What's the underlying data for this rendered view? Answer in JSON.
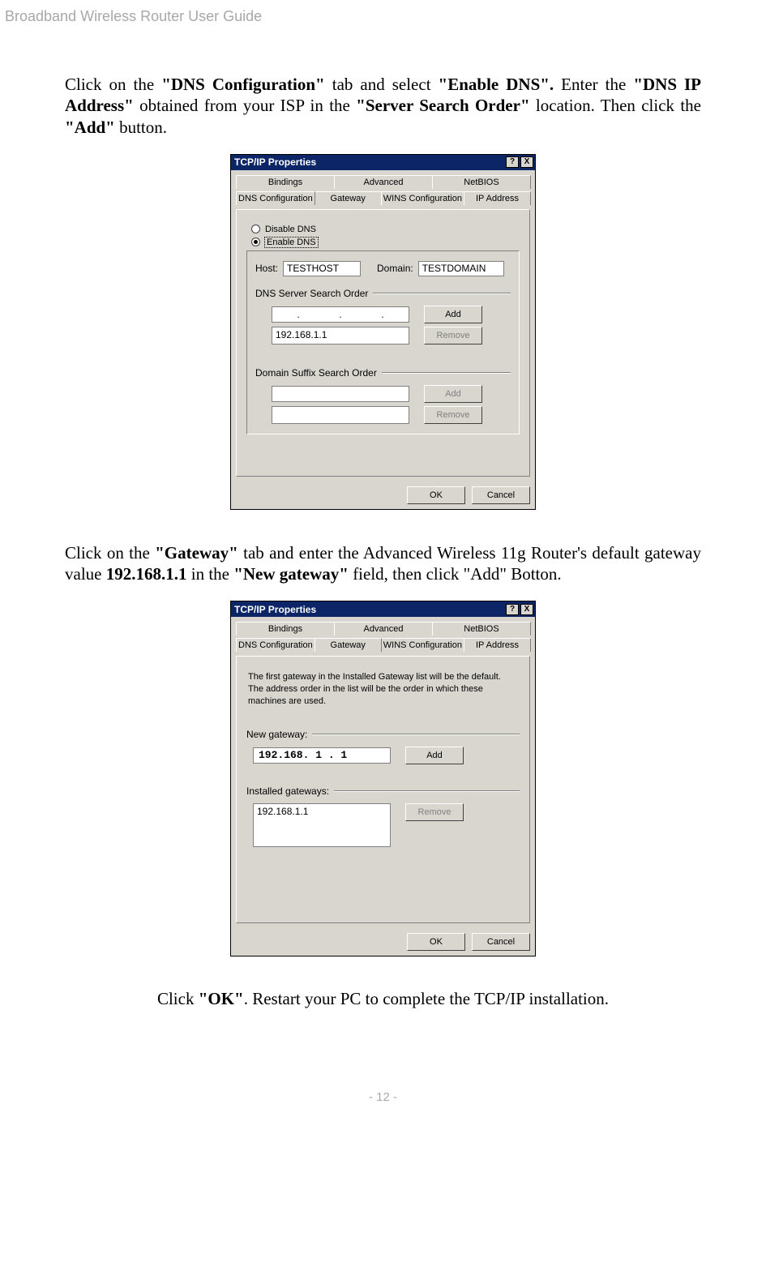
{
  "header": "Broadband Wireless Router User Guide",
  "footer": "- 12 -",
  "para1_pre": "Click on the ",
  "para1_b1": "\"DNS Configuration\"",
  "para1_m1": " tab and select ",
  "para1_b2": "\"Enable DNS\".",
  "para1_m2": " Enter the ",
  "para1_b3": "\"DNS IP Address\"",
  "para1_m3": " obtained from your ISP in the ",
  "para1_b4": "\"Server Search Order\"",
  "para1_m4": " location. Then click the ",
  "para1_b5": "\"Add\"",
  "para1_post": " button.",
  "dlg": {
    "title": "TCP/IP Properties",
    "help": "?",
    "close": "X",
    "tabs_top": [
      "Bindings",
      "Advanced",
      "NetBIOS"
    ],
    "tabs_bottom": [
      "DNS Configuration",
      "Gateway",
      "WINS Configuration",
      "IP Address"
    ],
    "disable_dns": "Disable DNS",
    "enable_dns": "Enable DNS",
    "host_label": "Host:",
    "host_value": "TESTHOST",
    "domain_label": "Domain:",
    "domain_value": "TESTDOMAIN",
    "server_search": "DNS Server Search Order",
    "add": "Add",
    "remove": "Remove",
    "server_list_item": "192.168.1.1",
    "domain_suffix": "Domain Suffix Search Order",
    "ok": "OK",
    "cancel": "Cancel"
  },
  "para2_pre": "Click on the ",
  "para2_b1": "\"Gateway\"",
  "para2_m1": " tab and enter the Advanced Wireless 11g Router's default gateway value ",
  "para2_b2": "192.168.1.1",
  "para2_m2": " in the ",
  "para2_b3": "\"New gateway\"",
  "para2_post": " field, then click \"Add\" Botton.",
  "dlg2": {
    "desc": "The first gateway in the Installed Gateway list will be the default. The address order in the list will be the order in which these machines are used.",
    "new_gw_label": "New gateway:",
    "new_gw_value": "192.168.  1  .  1",
    "installed_label": "Installed gateways:",
    "installed_item": "192.168.1.1"
  },
  "final_pre": "Click ",
  "final_b1": "\"OK\"",
  "final_post": ". Restart your PC to complete the TCP/IP installation."
}
